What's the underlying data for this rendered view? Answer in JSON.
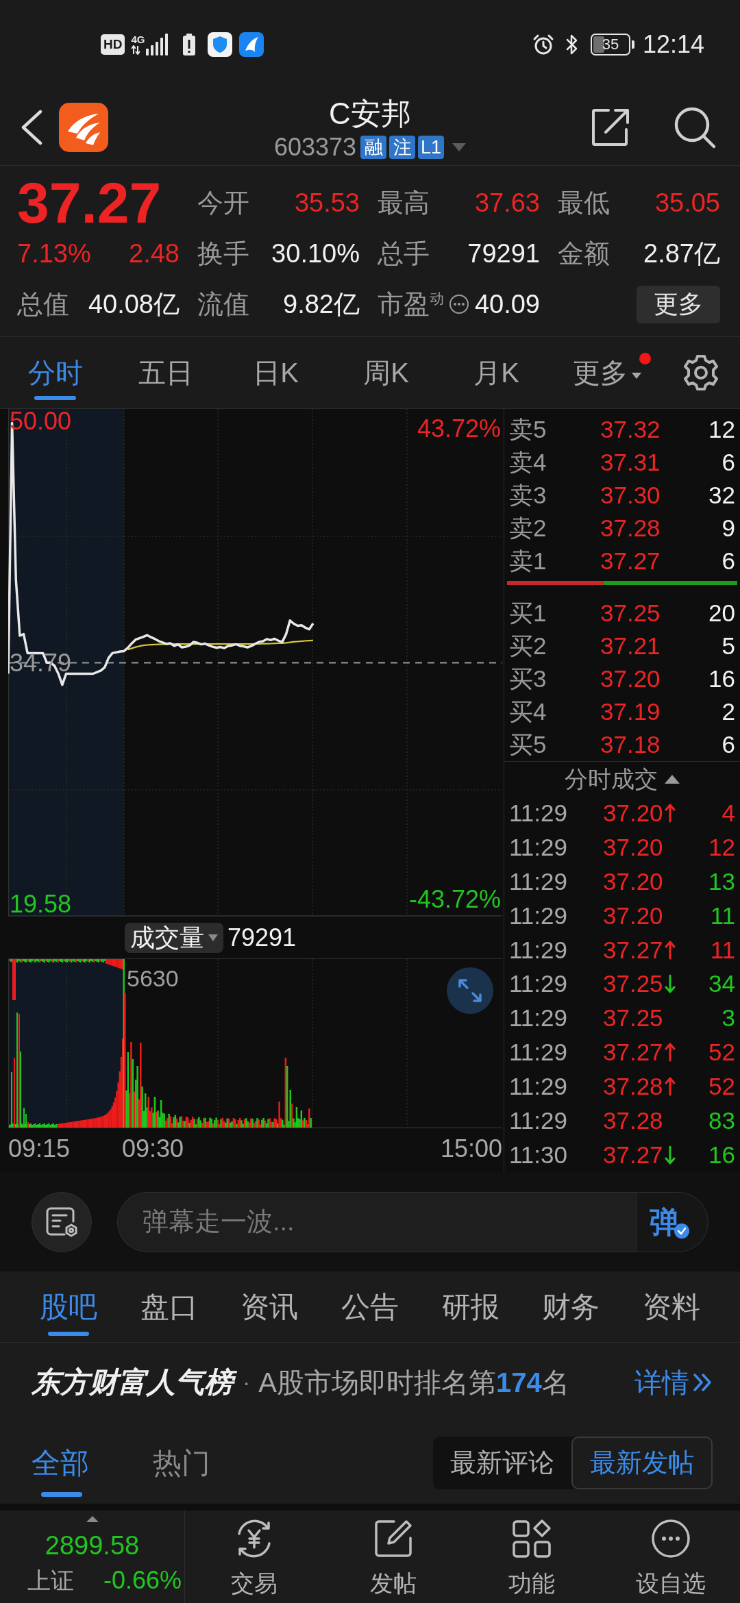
{
  "status_bar": {
    "hd": "HD",
    "network": "4G",
    "battery": "35",
    "time": "12:14"
  },
  "header": {
    "title": "C安邦",
    "code": "603373",
    "badges": [
      "融",
      "注",
      "L1"
    ]
  },
  "quote": {
    "price": "37.27",
    "change_pct": "7.13%",
    "change": "2.48",
    "rising": true,
    "total_value": {
      "label": "总值",
      "value": "40.08亿"
    },
    "stats": [
      {
        "label": "今开",
        "value": "35.53",
        "color": "#ee2424",
        "kind": "plain"
      },
      {
        "label": "最高",
        "value": "37.63",
        "color": "#ee2424",
        "kind": "plain"
      },
      {
        "label": "最低",
        "value": "35.05",
        "color": "#ee2424",
        "kind": "plain"
      },
      {
        "label": "换手",
        "value": "30.10%",
        "color": "#f2f2f2",
        "kind": "plain"
      },
      {
        "label": "总手",
        "value": "79291",
        "color": "#f2f2f2",
        "kind": "plain"
      },
      {
        "label": "金额",
        "value": "2.87亿",
        "color": "#f2f2f2",
        "kind": "plain"
      },
      {
        "label": "流值",
        "value": "9.82亿",
        "color": "#f2f2f2",
        "kind": "plain"
      },
      {
        "label": "市盈$^{动}$",
        "value": "40.09",
        "color": "#f2f2f2",
        "kind": "info"
      }
    ],
    "more_button": "更多"
  },
  "chart_tabs": [
    {
      "label": "分时",
      "selected": true,
      "kind": "tab",
      "dot": false
    },
    {
      "label": "五日",
      "selected": false,
      "kind": "tab",
      "dot": false
    },
    {
      "label": "日K",
      "selected": false,
      "kind": "tab",
      "dot": false
    },
    {
      "label": "周K",
      "selected": false,
      "kind": "tab",
      "dot": false
    },
    {
      "label": "月K",
      "selected": false,
      "kind": "tab",
      "dot": false
    },
    {
      "label": "更多",
      "selected": false,
      "kind": "dropdown",
      "dot": true
    }
  ],
  "price_chart": {
    "change_high": "43.72%",
    "change_low": "-43.72%",
    "chart_data": {
      "type": "line",
      "series": [
        {
          "color": "#e8e8e8",
          "values": [
            34.1,
            49.9,
            40.0,
            36.5,
            36.6,
            35.4,
            35.4,
            35.4,
            35.4,
            35.4,
            34.8,
            34.8,
            34.6,
            34.1,
            33.4,
            34.1,
            34.1,
            34.1,
            34.1,
            34.1,
            34.1,
            34.1,
            34.1,
            34.2,
            34.3,
            34.5,
            35.1,
            35.4,
            35.45,
            35.5,
            35.53,
            35.73,
            36.01,
            36.25,
            36.34,
            36.42,
            36.53,
            36.4,
            36.29,
            36.16,
            36.07,
            35.98,
            36.02,
            35.85,
            35.95,
            35.76,
            35.8,
            35.88,
            36.1,
            36.05,
            35.95,
            36.0,
            35.88,
            35.8,
            35.74,
            35.78,
            35.72,
            35.85,
            35.88,
            35.96,
            35.86,
            35.82,
            35.76,
            35.85,
            35.98,
            36.1,
            36.15,
            36.28,
            36.22,
            36.3,
            36.18,
            36.1,
            36.6,
            37.45,
            37.25,
            37.12,
            37.15,
            37.0,
            36.9,
            37.27,
            null,
            null,
            null,
            null,
            null,
            null,
            null,
            null,
            null,
            null,
            null,
            null,
            null,
            null,
            null,
            null,
            null,
            null,
            null,
            null,
            null,
            null,
            null,
            null,
            null,
            null,
            null,
            null,
            null,
            null,
            null,
            null,
            null,
            null,
            null,
            null,
            null,
            null,
            null,
            null,
            null,
            null,
            null,
            null,
            null,
            null,
            null,
            null,
            null
          ]
        },
        {
          "color": "#d9c93a",
          "values": [
            null,
            null,
            null,
            null,
            null,
            null,
            null,
            null,
            null,
            null,
            null,
            null,
            null,
            null,
            null,
            null,
            null,
            null,
            null,
            null,
            null,
            null,
            null,
            null,
            null,
            null,
            null,
            null,
            null,
            null,
            null,
            35.62,
            35.7,
            35.78,
            35.84,
            35.88,
            35.91,
            35.93,
            35.94,
            35.95,
            35.96,
            35.96,
            35.97,
            35.97,
            35.97,
            35.97,
            35.97,
            35.97,
            35.97,
            35.97,
            35.97,
            35.97,
            35.97,
            35.97,
            35.97,
            35.97,
            35.97,
            35.97,
            35.97,
            35.97,
            35.97,
            35.97,
            35.97,
            35.97,
            35.98,
            35.98,
            35.99,
            35.99,
            36.0,
            36.01,
            36.02,
            36.03,
            36.05,
            36.08,
            36.11,
            36.13,
            36.15,
            36.17,
            36.19,
            36.2,
            null,
            null,
            null,
            null,
            null,
            null,
            null,
            null,
            null,
            null,
            null,
            null,
            null,
            null,
            null,
            null,
            null,
            null,
            null,
            null,
            null,
            null,
            null,
            null,
            null,
            null,
            null,
            null,
            null,
            null,
            null,
            null,
            null,
            null,
            null,
            null,
            null,
            null,
            null,
            null,
            null,
            null,
            null,
            null,
            null,
            null,
            null,
            null,
            null
          ]
        }
      ],
      "ylim": [
        18.8,
        50.78
      ],
      "yticks": [
        {
          "value": 50.0,
          "label": "50.00"
        },
        {
          "value": 34.79,
          "label": "34.79"
        },
        {
          "value": 19.58,
          "label": "19.58"
        }
      ],
      "ref_lines": [
        {
          "axis": "y",
          "value": 34.79
        }
      ]
    }
  },
  "volume_chart": {
    "selector": "成交量",
    "total": "79291",
    "peak_label": "5630",
    "time_labels": [
      "09:15",
      "09:30",
      "15:00"
    ]
  },
  "order_book": {
    "asks": [
      {
        "label": "卖5",
        "price": "37.32",
        "volume": "12"
      },
      {
        "label": "卖4",
        "price": "37.31",
        "volume": "6"
      },
      {
        "label": "卖3",
        "price": "37.30",
        "volume": "32"
      },
      {
        "label": "卖2",
        "price": "37.28",
        "volume": "9"
      },
      {
        "label": "卖1",
        "price": "37.27",
        "volume": "6"
      }
    ],
    "ratio_bar": {
      "level": 0.42
    },
    "bids": [
      {
        "label": "买1",
        "price": "37.25",
        "volume": "20"
      },
      {
        "label": "买2",
        "price": "37.21",
        "volume": "5"
      },
      {
        "label": "买3",
        "price": "37.20",
        "volume": "16"
      },
      {
        "label": "买4",
        "price": "37.19",
        "volume": "2"
      },
      {
        "label": "买5",
        "price": "37.18",
        "volume": "6"
      }
    ]
  },
  "trades": {
    "title": "分时成交",
    "rows": [
      {
        "time": "11:29",
        "price": "37.20",
        "kind": "up",
        "volume": "4",
        "color": "#ee2424"
      },
      {
        "time": "11:29",
        "price": "37.20",
        "kind": "plain",
        "volume": "12",
        "color": "#ee2424"
      },
      {
        "time": "11:29",
        "price": "37.20",
        "kind": "plain",
        "volume": "13",
        "color": "#22c522"
      },
      {
        "time": "11:29",
        "price": "37.20",
        "kind": "plain",
        "volume": "11",
        "color": "#22c522"
      },
      {
        "time": "11:29",
        "price": "37.27",
        "kind": "up",
        "volume": "11",
        "color": "#ee2424"
      },
      {
        "time": "11:29",
        "price": "37.25",
        "kind": "down",
        "volume": "34",
        "color": "#22c522"
      },
      {
        "time": "11:29",
        "price": "37.25",
        "kind": "plain",
        "volume": "3",
        "color": "#22c522"
      },
      {
        "time": "11:29",
        "price": "37.27",
        "kind": "up",
        "volume": "52",
        "color": "#ee2424"
      },
      {
        "time": "11:29",
        "price": "37.28",
        "kind": "up",
        "volume": "52",
        "color": "#ee2424"
      },
      {
        "time": "11:29",
        "price": "37.28",
        "kind": "plain",
        "volume": "83",
        "color": "#22c522"
      },
      {
        "time": "11:30",
        "price": "37.27",
        "kind": "down",
        "volume": "16",
        "color": "#22c522"
      }
    ]
  },
  "comment_bar": {
    "placeholder": "弹幕走一波...",
    "send_label": "弹"
  },
  "section_tabs": [
    {
      "label": "股吧",
      "selected": true
    },
    {
      "label": "盘口",
      "selected": false
    },
    {
      "label": "资讯",
      "selected": false
    },
    {
      "label": "公告",
      "selected": false
    },
    {
      "label": "研报",
      "selected": false
    },
    {
      "label": "财务",
      "selected": false
    },
    {
      "label": "资料",
      "selected": false
    }
  ],
  "ranking": {
    "brand": "东方财富人气榜",
    "separator": "·",
    "text": "A股市场即时排名第**174**名",
    "link": "详情"
  },
  "post_tabs": [
    {
      "label": "全部",
      "selected": true
    },
    {
      "label": "热门",
      "selected": false
    }
  ],
  "sort_toggle": [
    {
      "label": "最新评论",
      "selected": false
    },
    {
      "label": "最新发帖",
      "selected": true
    }
  ],
  "bottom_bar": {
    "index": {
      "value": "2899.58",
      "name": "上证",
      "change": "-0.66%",
      "rising": false
    },
    "nav": [
      {
        "label": "交易"
      },
      {
        "label": "发帖"
      },
      {
        "label": "功能"
      },
      {
        "label": "设自选"
      }
    ]
  }
}
